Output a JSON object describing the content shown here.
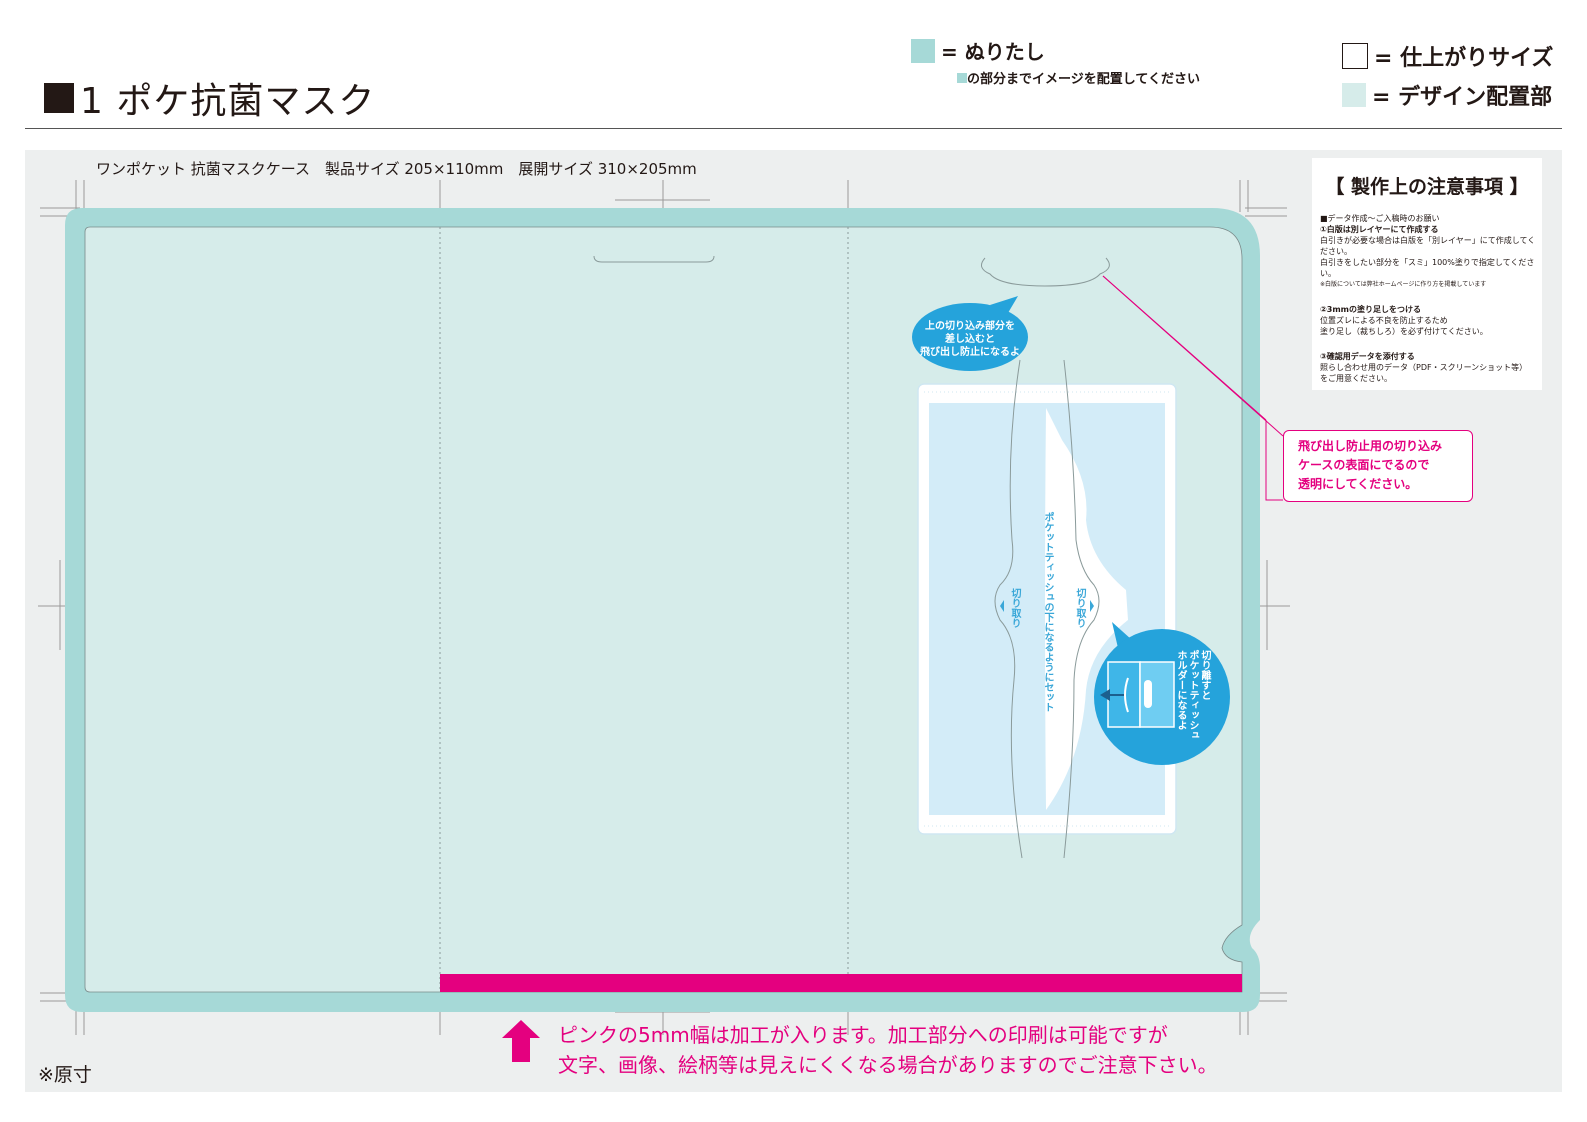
{
  "title": "1 ポケ抗菌マスク",
  "legend": {
    "nuritashi": "= ぬりたし",
    "nuritashi_sub": "の部分までイメージを配置してください",
    "finish": "= 仕上がりサイズ",
    "design": "= デザイン配置部"
  },
  "spec": "ワンポケット 抗菌マスクケース　製品サイズ 205×110mm　展開サイズ 310×205mm",
  "notes": {
    "heading": "【 製作上の注意事項 】",
    "intro": "■データ作成〜ご入稿時のお願い",
    "n1_title": "①白版は別レイヤーにて作成する",
    "n1_l1": "白引きが必要な場合は白版を「別レイヤー」にて作成してください。",
    "n1_l2": "白引きをしたい部分を「スミ」100%塗りで指定してください。",
    "n1_l3": "※白版については弊社ホームページに作り方を掲載しています",
    "n2_title": "②3mmの塗り足しをつける",
    "n2_l1": "位置ズレによる不良を防止するため",
    "n2_l2": "塗り足し（裁ちしろ）を必ず付けてください。",
    "n3_title": "③確認用データを添付する",
    "n3_l1": "照らし合わせ用のデータ（PDF・スクリーンショット等）",
    "n3_l2": "をご用意ください。"
  },
  "callout_pink": {
    "l1": "飛び出し防止用の切り込み",
    "l2": "ケースの表面にでるので",
    "l3": "透明にしてください。"
  },
  "bubble_top": {
    "l1": "上の切り込み部分を",
    "l2": "差し込むと",
    "l3": "飛び出し防止になるよ"
  },
  "bubble_bottom": {
    "l1": "切り離すと",
    "l2": "ポケットティッシュ",
    "l3": "ホルダーになるよ"
  },
  "cut_label": "切り取り",
  "tissue_label": "ポケットティッシュの下になるようにセット",
  "bottom_note": {
    "l1": "ピンクの5mm幅は加工が入ります。加工部分への印刷は可能ですが",
    "l2": "文字、画像、絵柄等は見えにくくなる場合がありますのでご注意下さい。"
  },
  "gensun": "※原寸",
  "colors": {
    "bleed": "#a6d9d7",
    "design": "#d6ecea",
    "pink": "#e4007f",
    "blue": "#25a3db",
    "tissue": "#d3ecf8"
  }
}
